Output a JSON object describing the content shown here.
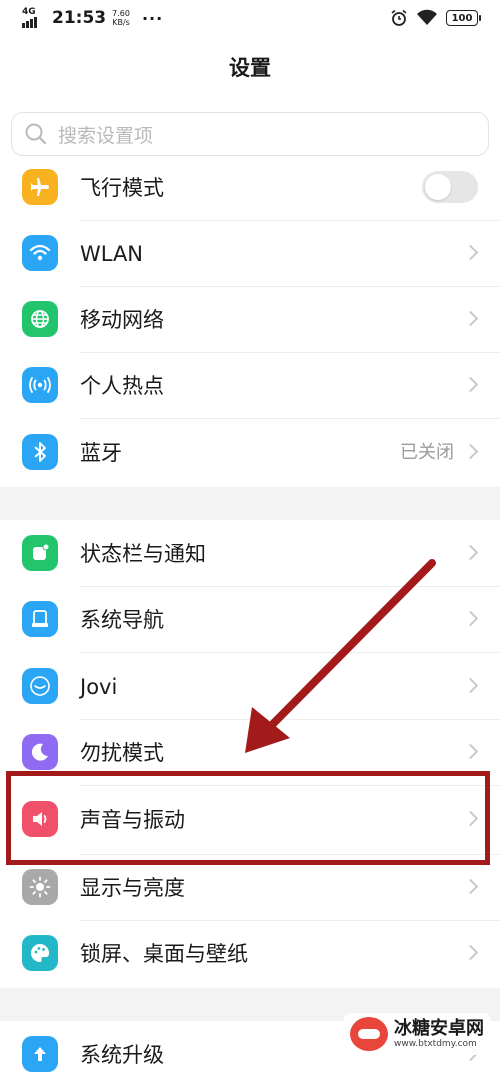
{
  "status_bar": {
    "network": "4G",
    "time": "21:53",
    "speed_value": "7.60",
    "speed_unit": "KB/s",
    "more": "···",
    "battery": "100"
  },
  "header": {
    "title": "设置"
  },
  "search": {
    "placeholder": "搜索设置项"
  },
  "section1": [
    {
      "label": "飞行模式",
      "icon": "airplane-icon",
      "color": "#F8B21F",
      "toggle_on": false
    },
    {
      "label": "WLAN",
      "icon": "wifi-icon",
      "color": "#2BA6F4"
    },
    {
      "label": "移动网络",
      "icon": "globe-icon",
      "color": "#22C56B"
    },
    {
      "label": "个人热点",
      "icon": "hotspot-icon",
      "color": "#2BA6F4"
    },
    {
      "label": "蓝牙",
      "icon": "bluetooth-icon",
      "color": "#2BA6F4",
      "value": "已关闭"
    }
  ],
  "section2": [
    {
      "label": "状态栏与通知",
      "icon": "notification-icon",
      "color": "#22C56B"
    },
    {
      "label": "系统导航",
      "icon": "navigation-icon",
      "color": "#2BA6F4"
    },
    {
      "label": "Jovi",
      "icon": "jovi-icon",
      "color": "#2BA6F4"
    },
    {
      "label": "勿扰模式",
      "icon": "moon-icon",
      "color": "#8E6BF2"
    },
    {
      "label": "声音与振动",
      "icon": "speaker-icon",
      "color": "#F0506A"
    },
    {
      "label": "显示与亮度",
      "icon": "sun-icon",
      "color": "#A9A9A9"
    },
    {
      "label": "锁屏、桌面与壁纸",
      "icon": "palette-icon",
      "color": "#23B8C7"
    }
  ],
  "section3": [
    {
      "label": "系统升级",
      "icon": "upgrade-icon",
      "color": "#2BA6F4"
    }
  ],
  "annotation": {
    "color": "#A31A1A"
  },
  "watermark": {
    "name": "冰糖安卓网",
    "url": "www.btxtdmy.com"
  }
}
